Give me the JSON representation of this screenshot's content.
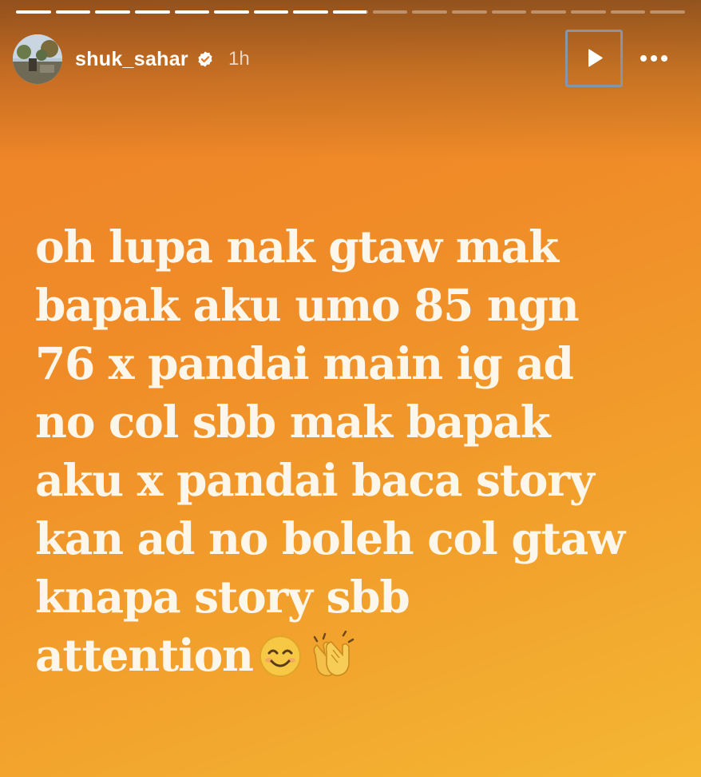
{
  "progress": {
    "segments": [
      1,
      1,
      1,
      1,
      1,
      1,
      1,
      1,
      0.95,
      0,
      0,
      0,
      0,
      0,
      0,
      0,
      0
    ],
    "active_index": 8
  },
  "header": {
    "username": "shuk_sahar",
    "verified_icon": "verified-badge-icon",
    "time": "1h",
    "play_icon": "play-icon",
    "more_icon": "more-horizontal-icon"
  },
  "story": {
    "lines": [
      "oh lupa nak gtaw mak",
      "bapak aku umo 85 ngn",
      "76 x pandai main ig ad",
      "no col sbb mak bapak",
      "aku x pandai baca story",
      "kan ad no boleh col gtaw",
      "knapa story sbb",
      "attention"
    ],
    "emoji": [
      "smiling-face-emoji",
      "clapping-hands-emoji"
    ]
  },
  "colors": {
    "gradient_start": "#ee8128",
    "gradient_end": "#f4b733",
    "text": "#fdf6ea",
    "focus_outline": "#8696a8"
  }
}
